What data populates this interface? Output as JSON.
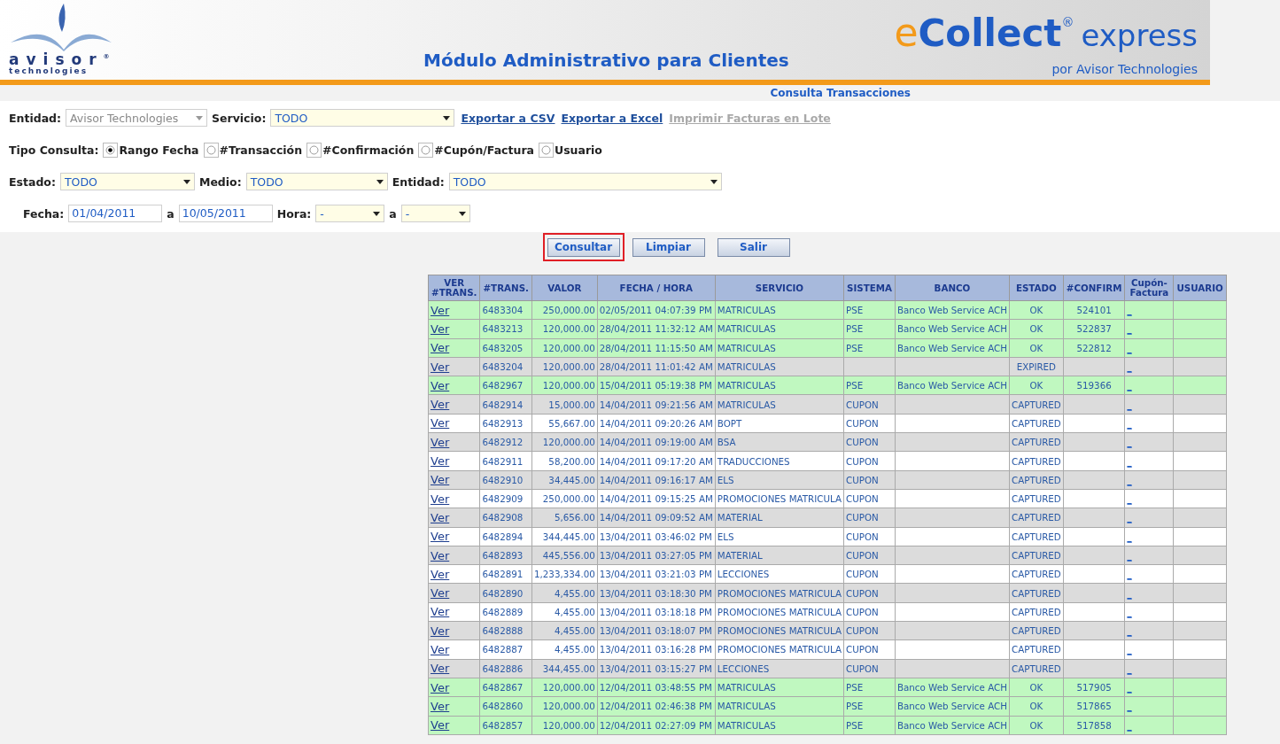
{
  "header": {
    "logo_word": "avisor",
    "logo_reg": "®",
    "logo_sub": "technologies",
    "title": "Módulo Administrativo para Clientes",
    "brand_e": "e",
    "brand_collect": "Collect",
    "brand_reg": "®",
    "brand_express": "express",
    "brand_by": "por Avisor Technologies"
  },
  "page_title": "Consulta Transacciones",
  "filters": {
    "entidad_label": "Entidad:",
    "entidad_value": "Avisor Technologies",
    "servicio_label": "Servicio:",
    "servicio_value": "TODO",
    "links": [
      {
        "label": "Exportar a CSV",
        "disabled": false
      },
      {
        "label": "Exportar a Excel",
        "disabled": false
      },
      {
        "label": "Imprimir Facturas en Lote",
        "disabled": true
      }
    ],
    "tipo_label": "Tipo Consulta:",
    "tipo_options": [
      {
        "label": "Rango Fecha",
        "selected": true
      },
      {
        "label": "#Transacción",
        "selected": false
      },
      {
        "label": "#Confirmación",
        "selected": false
      },
      {
        "label": "#Cupón/Factura",
        "selected": false
      },
      {
        "label": "Usuario",
        "selected": false
      }
    ],
    "estado_label": "Estado:",
    "estado_value": "TODO",
    "medio_label": "Medio:",
    "medio_value": "TODO",
    "entidad2_label": "Entidad:",
    "entidad2_value": "TODO",
    "fecha_label": "Fecha:",
    "fecha_from": "01/04/2011",
    "a_label": "a",
    "fecha_to": "10/05/2011",
    "hora_label": "Hora:",
    "hora_from": "-",
    "a2_label": "a",
    "hora_to": "-"
  },
  "buttons": [
    {
      "label": "Consultar",
      "highlighted": true
    },
    {
      "label": "Limpiar",
      "highlighted": false
    },
    {
      "label": "Salir",
      "highlighted": false
    }
  ],
  "table": {
    "columns": [
      "VER #TRANS.",
      "#TRANS.",
      "VALOR",
      "FECHA / HORA",
      "SERVICIO",
      "SISTEMA",
      "BANCO",
      "ESTADO",
      "#CONFIRM",
      "Cupón-Factura",
      "USUARIO"
    ],
    "rows": [
      {
        "kind": "ok",
        "cells": [
          "Ver",
          "6483304",
          "250,000.00",
          "02/05/2011 04:07:39 PM",
          "MATRICULAS",
          "PSE",
          "Banco Web Service ACH",
          "OK",
          "524101",
          "_",
          ""
        ]
      },
      {
        "kind": "ok",
        "cells": [
          "Ver",
          "6483213",
          "120,000.00",
          "28/04/2011 11:32:12 AM",
          "MATRICULAS",
          "PSE",
          "Banco Web Service ACH",
          "OK",
          "522837",
          "_",
          ""
        ]
      },
      {
        "kind": "ok",
        "cells": [
          "Ver",
          "6483205",
          "120,000.00",
          "28/04/2011 11:15:50 AM",
          "MATRICULAS",
          "PSE",
          "Banco Web Service ACH",
          "OK",
          "522812",
          "_",
          ""
        ]
      },
      {
        "kind": "other",
        "cells": [
          "Ver",
          "6483204",
          "120,000.00",
          "28/04/2011 11:01:42 AM",
          "MATRICULAS",
          "",
          "",
          "EXPIRED",
          "",
          "_",
          ""
        ]
      },
      {
        "kind": "ok",
        "cells": [
          "Ver",
          "6482967",
          "120,000.00",
          "15/04/2011 05:19:38 PM",
          "MATRICULAS",
          "PSE",
          "Banco Web Service ACH",
          "OK",
          "519366",
          "_",
          ""
        ]
      },
      {
        "kind": "other",
        "cells": [
          "Ver",
          "6482914",
          "15,000.00",
          "14/04/2011 09:21:56 AM",
          "MATRICULAS",
          "CUPON",
          "",
          "CAPTURED",
          "",
          "_",
          ""
        ]
      },
      {
        "kind": "other",
        "cells": [
          "Ver",
          "6482913",
          "55,667.00",
          "14/04/2011 09:20:26 AM",
          "BOPT",
          "CUPON",
          "",
          "CAPTURED",
          "",
          "_",
          ""
        ]
      },
      {
        "kind": "other",
        "cells": [
          "Ver",
          "6482912",
          "120,000.00",
          "14/04/2011 09:19:00 AM",
          "BSA",
          "CUPON",
          "",
          "CAPTURED",
          "",
          "_",
          ""
        ]
      },
      {
        "kind": "other",
        "cells": [
          "Ver",
          "6482911",
          "58,200.00",
          "14/04/2011 09:17:20 AM",
          "TRADUCCIONES",
          "CUPON",
          "",
          "CAPTURED",
          "",
          "_",
          ""
        ]
      },
      {
        "kind": "other",
        "cells": [
          "Ver",
          "6482910",
          "34,445.00",
          "14/04/2011 09:16:17 AM",
          "ELS",
          "CUPON",
          "",
          "CAPTURED",
          "",
          "_",
          ""
        ]
      },
      {
        "kind": "other",
        "cells": [
          "Ver",
          "6482909",
          "250,000.00",
          "14/04/2011 09:15:25 AM",
          "PROMOCIONES MATRICULA",
          "CUPON",
          "",
          "CAPTURED",
          "",
          "_",
          ""
        ]
      },
      {
        "kind": "other",
        "cells": [
          "Ver",
          "6482908",
          "5,656.00",
          "14/04/2011 09:09:52 AM",
          "MATERIAL",
          "CUPON",
          "",
          "CAPTURED",
          "",
          "_",
          ""
        ]
      },
      {
        "kind": "other",
        "cells": [
          "Ver",
          "6482894",
          "344,445.00",
          "13/04/2011 03:46:02 PM",
          "ELS",
          "CUPON",
          "",
          "CAPTURED",
          "",
          "_",
          ""
        ]
      },
      {
        "kind": "other",
        "cells": [
          "Ver",
          "6482893",
          "445,556.00",
          "13/04/2011 03:27:05 PM",
          "MATERIAL",
          "CUPON",
          "",
          "CAPTURED",
          "",
          "_",
          ""
        ]
      },
      {
        "kind": "other",
        "cells": [
          "Ver",
          "6482891",
          "1,233,334.00",
          "13/04/2011 03:21:03 PM",
          "LECCIONES",
          "CUPON",
          "",
          "CAPTURED",
          "",
          "_",
          ""
        ]
      },
      {
        "kind": "other",
        "cells": [
          "Ver",
          "6482890",
          "4,455.00",
          "13/04/2011 03:18:30 PM",
          "PROMOCIONES MATRICULA",
          "CUPON",
          "",
          "CAPTURED",
          "",
          "_",
          ""
        ]
      },
      {
        "kind": "other",
        "cells": [
          "Ver",
          "6482889",
          "4,455.00",
          "13/04/2011 03:18:18 PM",
          "PROMOCIONES MATRICULA",
          "CUPON",
          "",
          "CAPTURED",
          "",
          "_",
          ""
        ]
      },
      {
        "kind": "other",
        "cells": [
          "Ver",
          "6482888",
          "4,455.00",
          "13/04/2011 03:18:07 PM",
          "PROMOCIONES MATRICULA",
          "CUPON",
          "",
          "CAPTURED",
          "",
          "_",
          ""
        ]
      },
      {
        "kind": "other",
        "cells": [
          "Ver",
          "6482887",
          "4,455.00",
          "13/04/2011 03:16:28 PM",
          "PROMOCIONES MATRICULA",
          "CUPON",
          "",
          "CAPTURED",
          "",
          "_",
          ""
        ]
      },
      {
        "kind": "other",
        "cells": [
          "Ver",
          "6482886",
          "344,455.00",
          "13/04/2011 03:15:27 PM",
          "LECCIONES",
          "CUPON",
          "",
          "CAPTURED",
          "",
          "_",
          ""
        ]
      },
      {
        "kind": "ok",
        "cells": [
          "Ver",
          "6482867",
          "120,000.00",
          "12/04/2011 03:48:55 PM",
          "MATRICULAS",
          "PSE",
          "Banco Web Service ACH",
          "OK",
          "517905",
          "_",
          ""
        ]
      },
      {
        "kind": "ok",
        "cells": [
          "Ver",
          "6482860",
          "120,000.00",
          "12/04/2011 02:46:38 PM",
          "MATRICULAS",
          "PSE",
          "Banco Web Service ACH",
          "OK",
          "517865",
          "_",
          ""
        ]
      },
      {
        "kind": "ok",
        "cells": [
          "Ver",
          "6482857",
          "120,000.00",
          "12/04/2011 02:27:09 PM",
          "MATRICULAS",
          "PSE",
          "Banco Web Service ACH",
          "OK",
          "517858",
          "_",
          ""
        ]
      }
    ]
  }
}
